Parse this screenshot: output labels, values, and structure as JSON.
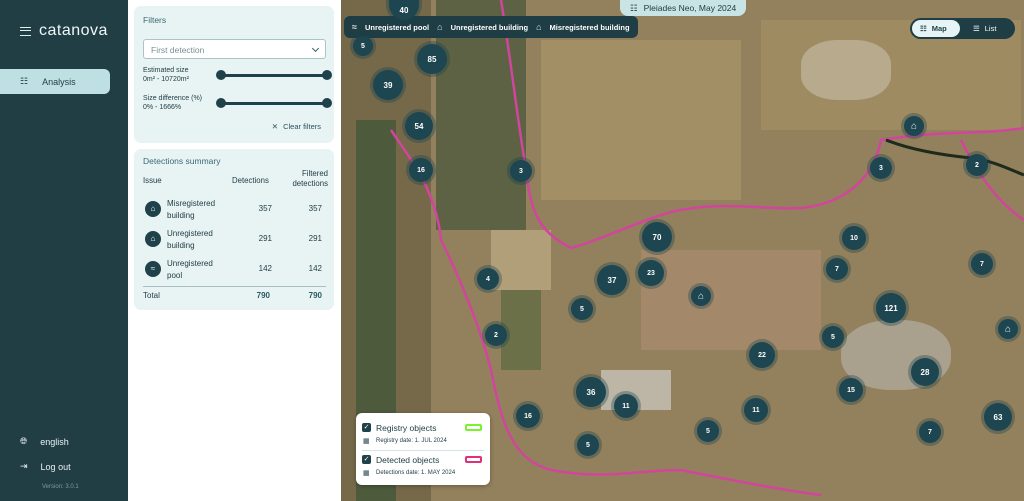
{
  "app": {
    "brand": "catanova",
    "version": "Version: 3.0.1"
  },
  "nav": {
    "analysis": "Analysis",
    "language": "english",
    "logout": "Log out"
  },
  "filters": {
    "title": "Filters",
    "detection_select": "First detection",
    "size_label": "Estimated size",
    "size_range": "0m² - 10720m²",
    "diff_label": "Size difference (%)",
    "diff_range": "0% - 1666%",
    "clear": "Clear filters"
  },
  "summary": {
    "title": "Detections summary",
    "headers": {
      "issue": "Issue",
      "detections": "Detections",
      "filtered": "Filtered detections"
    },
    "rows": [
      {
        "icon": "misregistered-building-icon",
        "line1": "Misregistered",
        "line2": "building",
        "detections": "357",
        "filtered": "357"
      },
      {
        "icon": "unregistered-building-icon",
        "line1": "Unregistered",
        "line2": "building",
        "detections": "291",
        "filtered": "291"
      },
      {
        "icon": "unregistered-pool-icon",
        "line1": "Unregistered",
        "line2": "pool",
        "detections": "142",
        "filtered": "142"
      }
    ],
    "total": {
      "label": "Total",
      "detections": "790",
      "filtered": "790"
    }
  },
  "map": {
    "source_pill": "Pleiades Neo, May 2024",
    "legend_top": [
      "Unregistered pool",
      "Unregistered building",
      "Misregistered building"
    ],
    "view_toggle": {
      "map": "Map",
      "list": "List",
      "active": "Map"
    },
    "cluster_counts": [
      "40",
      "5",
      "85",
      "39",
      "54",
      "16",
      "3",
      "2",
      "3",
      "70",
      "10",
      "4",
      "37",
      "23",
      "7",
      "7",
      "5",
      "121",
      "2",
      "5",
      "22",
      "36",
      "15",
      "28",
      "16",
      "11",
      "11",
      "63",
      "5",
      "7",
      "5"
    ],
    "bottom_legend": {
      "registry": {
        "label": "Registry objects",
        "date": "Registry date: 1. JUL 2024",
        "color": "#7bf22e",
        "checked": true
      },
      "detected": {
        "label": "Detected objects",
        "date": "Detections date: 1. MAY 2024",
        "color": "#e0307c",
        "checked": true
      }
    }
  }
}
